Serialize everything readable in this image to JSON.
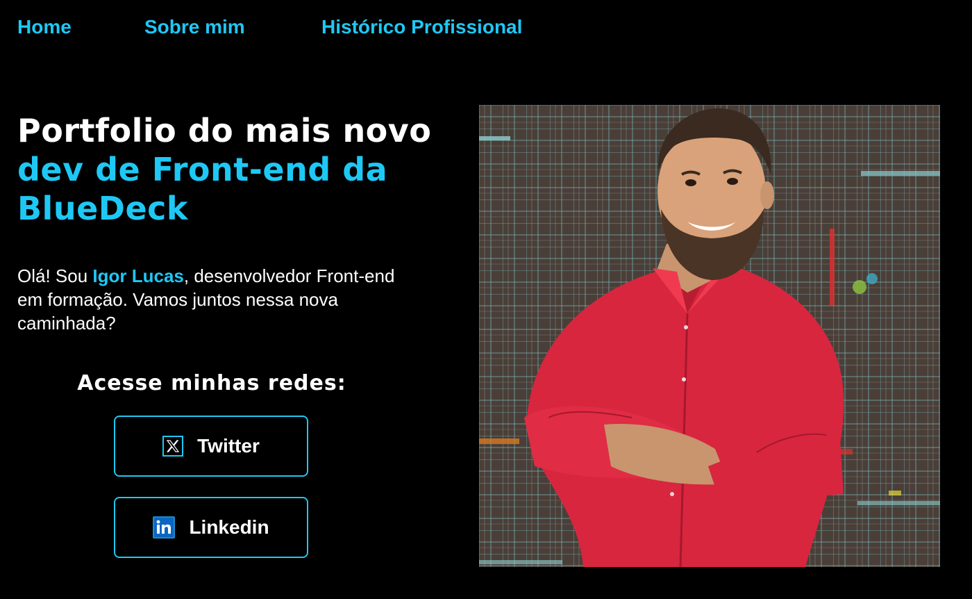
{
  "nav": {
    "items": [
      {
        "label": "Home"
      },
      {
        "label": "Sobre mim"
      },
      {
        "label": "Histórico Profissional"
      }
    ]
  },
  "hero": {
    "headline_part1": "Portfolio do mais novo ",
    "headline_highlight": "dev de Front-end da BlueDeck",
    "intro_before": "Olá! Sou ",
    "intro_name": "Igor Lucas",
    "intro_after": ", desenvolvedor Front-end em formação. Vamos juntos nessa nova caminhada?"
  },
  "social": {
    "title": "Acesse minhas redes:",
    "buttons": [
      {
        "label": "Twitter",
        "icon": "x-twitter-icon"
      },
      {
        "label": "Linkedin",
        "icon": "linkedin-icon"
      }
    ]
  },
  "colors": {
    "background": "#000000",
    "accent": "#1ec8f5",
    "text": "#ffffff",
    "shirt": "#d8263e"
  }
}
